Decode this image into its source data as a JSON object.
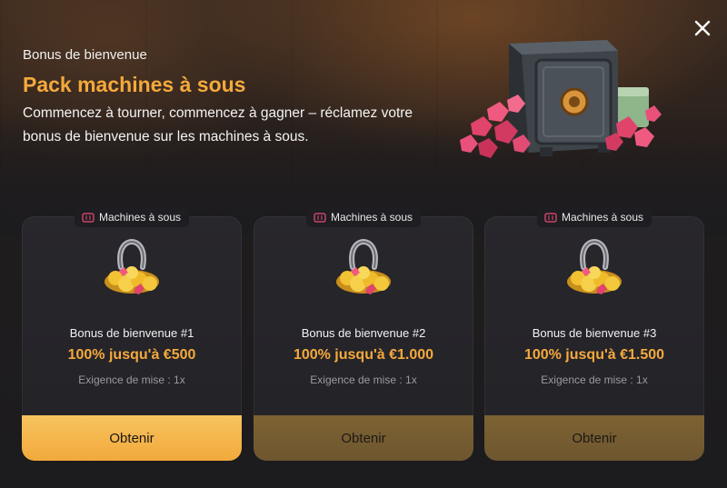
{
  "modal": {
    "eyebrow": "Bonus de bienvenue",
    "title": "Pack machines à sous",
    "description": "Commencez à tourner, commencez à gagner – réclamez votre bonus de bienvenue sur les machines à sous.",
    "close_icon": "close-icon",
    "accent_color": "#f5a93c"
  },
  "cards": [
    {
      "tag": "Machines à sous",
      "tag_icon": "slot-machine-icon",
      "title": "Bonus de bienvenue #1",
      "amount": "100% jusqu'à €500",
      "requirement": "Exigence de mise : 1x",
      "button": "Obtenir",
      "button_style": "active"
    },
    {
      "tag": "Machines à sous",
      "tag_icon": "slot-machine-icon",
      "title": "Bonus de bienvenue #2",
      "amount": "100% jusqu'à €1.000",
      "requirement": "Exigence de mise : 1x",
      "button": "Obtenir",
      "button_style": "muted"
    },
    {
      "tag": "Machines à sous",
      "tag_icon": "slot-machine-icon",
      "title": "Bonus de bienvenue #3",
      "amount": "100% jusqu'à €1.500",
      "requirement": "Exigence de mise : 1x",
      "button": "Obtenir",
      "button_style": "muted"
    }
  ]
}
